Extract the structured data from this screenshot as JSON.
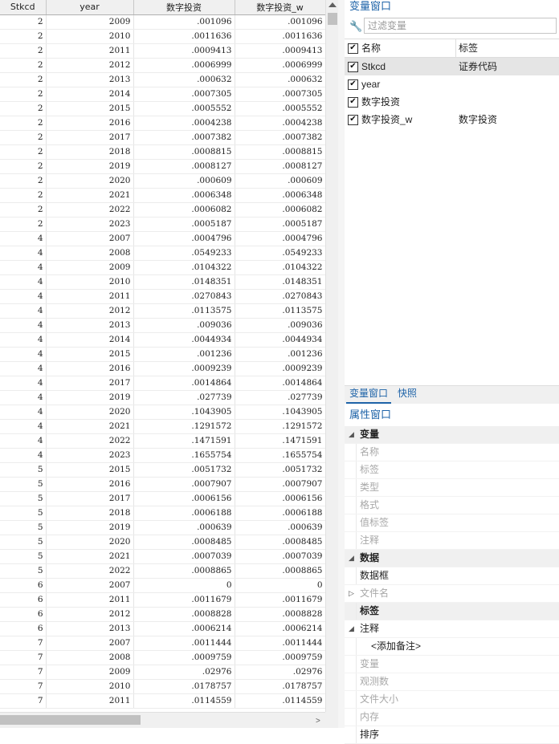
{
  "grid": {
    "columns": [
      "Stkcd",
      "year",
      "数字投资",
      "数字投资_w"
    ],
    "rows": [
      [
        "2",
        "2009",
        ".001096",
        ".001096"
      ],
      [
        "2",
        "2010",
        ".0011636",
        ".0011636"
      ],
      [
        "2",
        "2011",
        ".0009413",
        ".0009413"
      ],
      [
        "2",
        "2012",
        ".0006999",
        ".0006999"
      ],
      [
        "2",
        "2013",
        ".000632",
        ".000632"
      ],
      [
        "2",
        "2014",
        ".0007305",
        ".0007305"
      ],
      [
        "2",
        "2015",
        ".0005552",
        ".0005552"
      ],
      [
        "2",
        "2016",
        ".0004238",
        ".0004238"
      ],
      [
        "2",
        "2017",
        ".0007382",
        ".0007382"
      ],
      [
        "2",
        "2018",
        ".0008815",
        ".0008815"
      ],
      [
        "2",
        "2019",
        ".0008127",
        ".0008127"
      ],
      [
        "2",
        "2020",
        ".000609",
        ".000609"
      ],
      [
        "2",
        "2021",
        ".0006348",
        ".0006348"
      ],
      [
        "2",
        "2022",
        ".0006082",
        ".0006082"
      ],
      [
        "2",
        "2023",
        ".0005187",
        ".0005187"
      ],
      [
        "4",
        "2007",
        ".0004796",
        ".0004796"
      ],
      [
        "4",
        "2008",
        ".0549233",
        ".0549233"
      ],
      [
        "4",
        "2009",
        ".0104322",
        ".0104322"
      ],
      [
        "4",
        "2010",
        ".0148351",
        ".0148351"
      ],
      [
        "4",
        "2011",
        ".0270843",
        ".0270843"
      ],
      [
        "4",
        "2012",
        ".0113575",
        ".0113575"
      ],
      [
        "4",
        "2013",
        ".009036",
        ".009036"
      ],
      [
        "4",
        "2014",
        ".0044934",
        ".0044934"
      ],
      [
        "4",
        "2015",
        ".001236",
        ".001236"
      ],
      [
        "4",
        "2016",
        ".0009239",
        ".0009239"
      ],
      [
        "4",
        "2017",
        ".0014864",
        ".0014864"
      ],
      [
        "4",
        "2019",
        ".027739",
        ".027739"
      ],
      [
        "4",
        "2020",
        ".1043905",
        ".1043905"
      ],
      [
        "4",
        "2021",
        ".1291572",
        ".1291572"
      ],
      [
        "4",
        "2022",
        ".1471591",
        ".1471591"
      ],
      [
        "4",
        "2023",
        ".1655754",
        ".1655754"
      ],
      [
        "5",
        "2015",
        ".0051732",
        ".0051732"
      ],
      [
        "5",
        "2016",
        ".0007907",
        ".0007907"
      ],
      [
        "5",
        "2017",
        ".0006156",
        ".0006156"
      ],
      [
        "5",
        "2018",
        ".0006188",
        ".0006188"
      ],
      [
        "5",
        "2019",
        ".000639",
        ".000639"
      ],
      [
        "5",
        "2020",
        ".0008485",
        ".0008485"
      ],
      [
        "5",
        "2021",
        ".0007039",
        ".0007039"
      ],
      [
        "5",
        "2022",
        ".0008865",
        ".0008865"
      ],
      [
        "6",
        "2007",
        "0",
        "0"
      ],
      [
        "6",
        "2011",
        ".0011679",
        ".0011679"
      ],
      [
        "6",
        "2012",
        ".0008828",
        ".0008828"
      ],
      [
        "6",
        "2013",
        ".0006214",
        ".0006214"
      ],
      [
        "7",
        "2007",
        ".0011444",
        ".0011444"
      ],
      [
        "7",
        "2008",
        ".0009759",
        ".0009759"
      ],
      [
        "7",
        "2009",
        ".02976",
        ".02976"
      ],
      [
        "7",
        "2010",
        ".0178757",
        ".0178757"
      ],
      [
        "7",
        "2011",
        ".0114559",
        ".0114559"
      ]
    ]
  },
  "variables_window": {
    "title": "变量窗口",
    "filter_placeholder": "过滤变量",
    "header": {
      "name": "名称",
      "label": "标签"
    },
    "variables": [
      {
        "name": "Stkcd",
        "label": "证券代码",
        "checked": true
      },
      {
        "name": "year",
        "label": "",
        "checked": true
      },
      {
        "name": "数字投资",
        "label": "",
        "checked": true
      },
      {
        "name": "数字投资_w",
        "label": "数字投资",
        "checked": true
      }
    ]
  },
  "tabs": {
    "variables": "变量窗口",
    "snapshots": "快照"
  },
  "properties_window": {
    "title": "属性窗口",
    "rows": [
      {
        "kind": "cat",
        "text": "变量"
      },
      {
        "kind": "item",
        "text": "名称"
      },
      {
        "kind": "item",
        "text": "标签"
      },
      {
        "kind": "item",
        "text": "类型"
      },
      {
        "kind": "item",
        "text": "格式"
      },
      {
        "kind": "item",
        "text": "值标签"
      },
      {
        "kind": "item",
        "text": "注释"
      },
      {
        "kind": "cat",
        "text": "数据"
      },
      {
        "kind": "sub",
        "text": "数据框"
      },
      {
        "kind": "collapsed",
        "text": "文件名"
      },
      {
        "kind": "catlite",
        "text": "标签"
      },
      {
        "kind": "expand",
        "text": "注释"
      },
      {
        "kind": "note",
        "text": "<添加备注>"
      },
      {
        "kind": "item",
        "text": "变量"
      },
      {
        "kind": "item",
        "text": "观测数"
      },
      {
        "kind": "item",
        "text": "文件大小"
      },
      {
        "kind": "item",
        "text": "内存"
      },
      {
        "kind": "sub",
        "text": "排序"
      }
    ]
  },
  "icons": {
    "check": "✔",
    "wrench": "🔧",
    "collapse": "◢",
    "expand": "▷"
  }
}
